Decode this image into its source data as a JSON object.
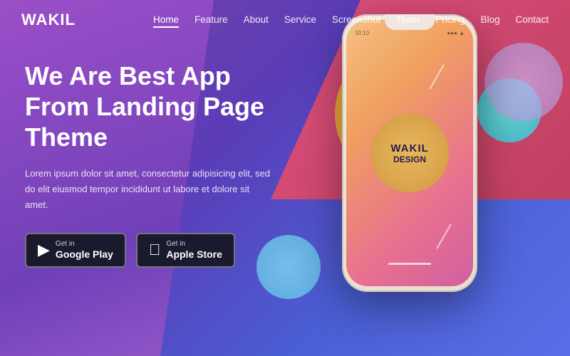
{
  "logo": "WAKIL",
  "nav": {
    "links": [
      {
        "label": "Home",
        "active": true
      },
      {
        "label": "Feature",
        "active": false
      },
      {
        "label": "About",
        "active": false
      },
      {
        "label": "Service",
        "active": false
      },
      {
        "label": "Screenshot",
        "active": false
      },
      {
        "label": "Team",
        "active": false
      },
      {
        "label": "Pricing",
        "active": false
      },
      {
        "label": "Blog",
        "active": false
      },
      {
        "label": "Contact",
        "active": false
      }
    ]
  },
  "hero": {
    "title": "We Are Best App From Landing Page Theme",
    "description": "Lorem ipsum dolor sit amet, consectetur adipisicing elit, sed do elit eiusmod tempor incididunt ut labore et dolore sit amet.",
    "google_play_small": "Get in",
    "google_play_large": "Google Play",
    "apple_store_small": "Get in",
    "apple_store_large": "Apple Store"
  },
  "phone": {
    "brand": "WAKIL",
    "sub": "DESIGN",
    "status_left": "10:10",
    "status_right": "●●● ▲"
  }
}
